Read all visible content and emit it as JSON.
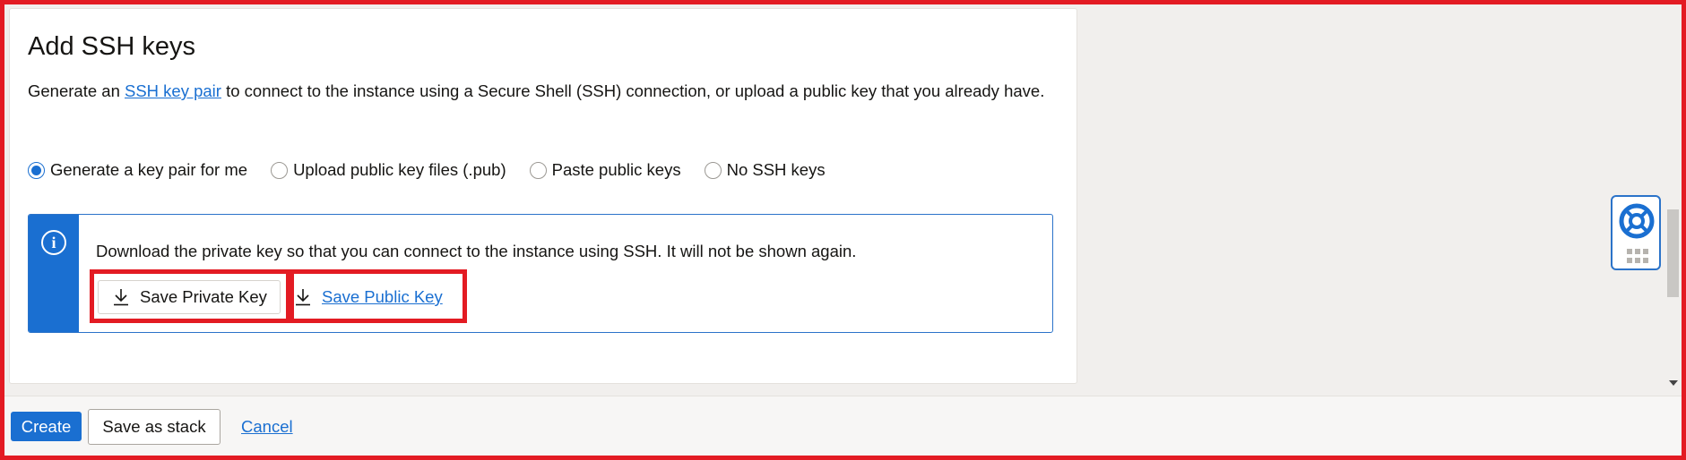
{
  "section": {
    "title": "Add SSH keys",
    "desc_before": "Generate an ",
    "desc_link": "SSH key pair",
    "desc_after": " to connect to the instance using a Secure Shell (SSH) connection, or upload a public key that you already have."
  },
  "radios": [
    {
      "label": "Generate a key pair for me",
      "checked": true
    },
    {
      "label": "Upload public key files (.pub)",
      "checked": false
    },
    {
      "label": "Paste public keys",
      "checked": false
    },
    {
      "label": "No SSH keys",
      "checked": false
    }
  ],
  "info": {
    "icon": "info-icon",
    "text": "Download the private key so that you can connect to the instance using SSH. It will not be shown again.",
    "save_private_label": "Save Private Key",
    "save_public_label": "Save Public Key"
  },
  "footer": {
    "create_label": "Create",
    "save_stack_label": "Save as stack",
    "cancel_label": "Cancel"
  },
  "colors": {
    "accent": "#1a6fd1",
    "highlight": "#e31b23"
  },
  "widget": {
    "icon": "lifebuoy-icon"
  }
}
